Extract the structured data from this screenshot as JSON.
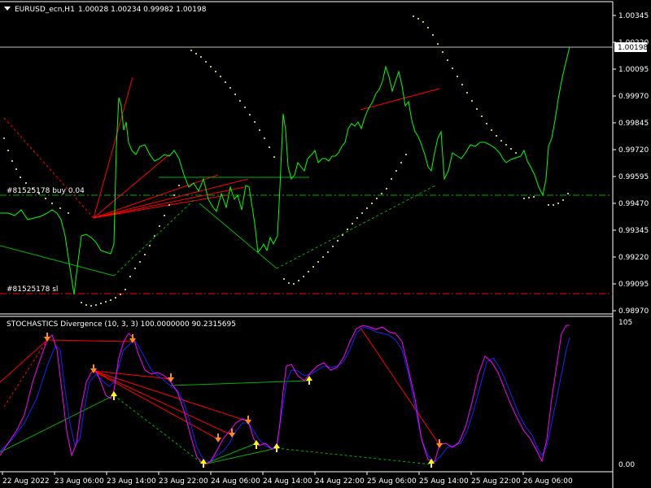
{
  "main": {
    "header_symbol": "EURUSD_ecn,H1",
    "header_ohlc": "1.00028 1.00234 0.99982 1.00198",
    "price_labels": [
      "1.00345",
      "1.00220",
      "1.00095",
      "0.99970",
      "0.99845",
      "0.99720",
      "0.99595",
      "0.99470",
      "0.99345",
      "0.99220",
      "0.99095",
      "0.98970"
    ],
    "current_price": "1.00198",
    "order_buy_label": "#81525178 buy 0.04",
    "order_sl_label": "#81525178 sl"
  },
  "indicator": {
    "title": "STOCHASTICS Divergence (10, 3, 3) 100.0000000 90.2315695",
    "scale_top": "105",
    "scale_bottom": "0.00"
  },
  "time_labels": [
    "22 Aug 2022",
    "23 Aug 06:00",
    "23 Aug 14:00",
    "23 Aug 22:00",
    "24 Aug 06:00",
    "24 Aug 14:00",
    "24 Aug 22:00",
    "25 Aug 06:00",
    "25 Aug 14:00",
    "25 Aug 22:00",
    "26 Aug 06:00"
  ],
  "colors": {
    "price_line": "#00ff00",
    "sar_dots": "#ffff99",
    "bearish": "#ff0000",
    "bullish": "#00c000",
    "stoch_main": "#ff00ff",
    "stoch_signal": "#0000ff",
    "arrow_down": "#ff8c1a",
    "arrow_up": "#ffff00"
  }
}
